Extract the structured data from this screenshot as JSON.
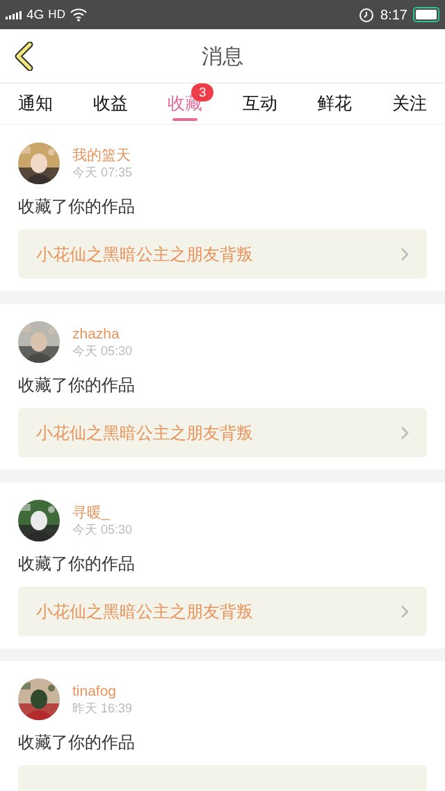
{
  "status_bar": {
    "network": "4G",
    "hd": "HD",
    "time": "8:17"
  },
  "header": {
    "title": "消息"
  },
  "tabs": [
    {
      "label": "通知",
      "selected": false
    },
    {
      "label": "收益",
      "selected": false
    },
    {
      "label": "收藏",
      "selected": true,
      "badge": "3"
    },
    {
      "label": "互动",
      "selected": false
    },
    {
      "label": "鲜花",
      "selected": false
    },
    {
      "label": "关注",
      "selected": false
    }
  ],
  "messages": [
    {
      "user": "我的篮天",
      "time": "今天 07:35",
      "text": "收藏了你的作品",
      "work": "小花仙之黑暗公主之朋友背叛"
    },
    {
      "user": "zhazha",
      "time": "今天 05:30",
      "text": "收藏了你的作品",
      "work": "小花仙之黑暗公主之朋友背叛"
    },
    {
      "user": "寻暖_",
      "time": "今天 05:30",
      "text": "收藏了你的作品",
      "work": "小花仙之黑暗公主之朋友背叛"
    },
    {
      "user": "tinafog",
      "time": "昨天 16:39",
      "text": "收藏了你的作品"
    }
  ]
}
